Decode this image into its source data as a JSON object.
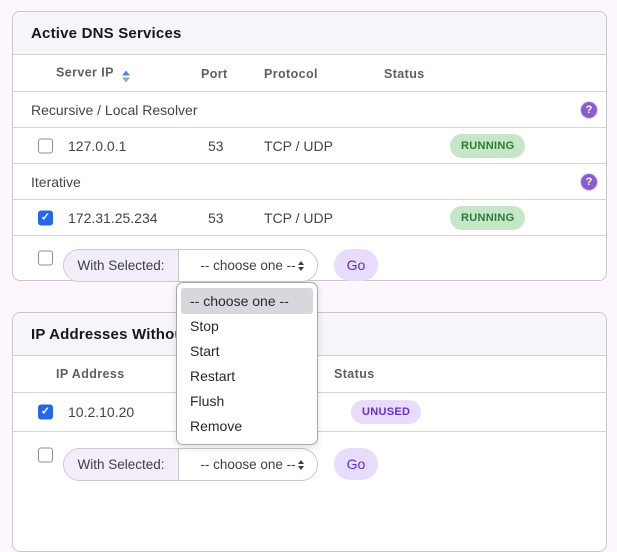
{
  "icons": {
    "help_glyph": "?",
    "check_glyph": "✓"
  },
  "colors": {
    "page_background": "#fdf6fd",
    "accent_purple": "#8a5cd0",
    "running_badge_bg": "#c5e7c8",
    "running_badge_text": "#2c7a38",
    "unused_badge_bg": "#e7dcfa",
    "unused_badge_text": "#6930c9",
    "go_button_bg": "#e7dcfb",
    "go_button_text": "#5f2ec0",
    "checkbox_checked": "#2368e8",
    "sort_active_arrow": "#3d8af7"
  },
  "active_dns": {
    "title": "Active DNS Services",
    "columns": [
      "Server IP",
      "Port",
      "Protocol",
      "Status"
    ],
    "section1": {
      "label": "Recursive / Local Resolver"
    },
    "row1": {
      "checked": false,
      "ip": "127.0.0.1",
      "port": "53",
      "protocol": "TCP / UDP",
      "status": "RUNNING"
    },
    "section2": {
      "label": "Iterative"
    },
    "row2": {
      "checked": true,
      "ip": "172.31.25.234",
      "port": "53",
      "protocol": "TCP / UDP",
      "status": "RUNNING"
    },
    "footer": {
      "label": "With Selected:",
      "selected_option": "-- choose one --",
      "go": "Go"
    }
  },
  "ip_addresses": {
    "title": "IP Addresses Without",
    "columns": [
      "IP Address",
      "Status"
    ],
    "row1": {
      "checked": true,
      "ip": "10.2.10.20",
      "status": "UNUSED"
    },
    "footer": {
      "label": "With Selected:",
      "selected_option": "-- choose one --",
      "go": "Go"
    }
  },
  "dropdown": {
    "highlighted": "-- choose one --",
    "items": [
      "-- choose one --",
      "Stop",
      "Start",
      "Restart",
      "Flush",
      "Remove"
    ]
  }
}
